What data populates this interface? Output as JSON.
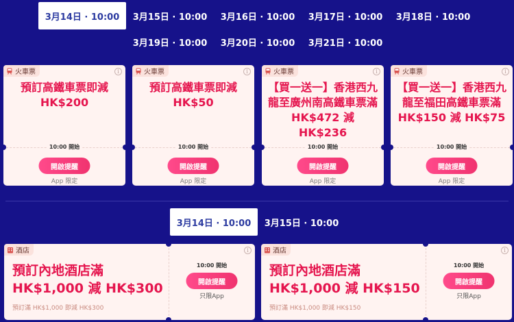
{
  "train_dates": [
    {
      "label": "3月14日 · 10:00",
      "active": true
    },
    {
      "label": "3月15日 · 10:00",
      "active": false
    },
    {
      "label": "3月16日 · 10:00",
      "active": false
    },
    {
      "label": "3月17日 · 10:00",
      "active": false
    },
    {
      "label": "3月18日 · 10:00",
      "active": false
    },
    {
      "label": "3月19日 · 10:00",
      "active": false
    },
    {
      "label": "3月20日 · 10:00",
      "active": false
    },
    {
      "label": "3月21日 · 10:00",
      "active": false
    }
  ],
  "train_cards": [
    {
      "tag": "火車票",
      "title": "預訂高鐵車票即減 HK$200",
      "time": "10:00 開始",
      "button": "開啟提醒",
      "limit": "App 限定"
    },
    {
      "tag": "火車票",
      "title": "預訂高鐵車票即減 HK$50",
      "time": "10:00 開始",
      "button": "開啟提醒",
      "limit": "App 限定"
    },
    {
      "tag": "火車票",
      "title": "【買一送一】香港西九龍至廣州南高鐵車票滿 HK$472 減 HK$236",
      "time": "10:00 開始",
      "button": "開啟提醒",
      "limit": "App 限定"
    },
    {
      "tag": "火車票",
      "title": "【買一送一】香港西九龍至福田高鐵車票滿 HK$150 減 HK$75",
      "time": "10:00 開始",
      "button": "開啟提醒",
      "limit": "App 限定"
    }
  ],
  "hotel_dates": [
    {
      "label": "3月14日 · 10:00",
      "active": true
    },
    {
      "label": "3月15日 · 10:00",
      "active": false
    }
  ],
  "hotel_cards": [
    {
      "tag": "酒店",
      "title_line1": "預訂內地酒店滿",
      "title_line2": "HK$1,000 減 HK$300",
      "subtitle": "預訂滿 HK$1,000 即減 HK$300",
      "time": "10:00 開始",
      "button": "開啟提醒",
      "limit": "只限App"
    },
    {
      "tag": "酒店",
      "title_line1": "預訂內地酒店滿",
      "title_line2": "HK$1,000 減 HK$150",
      "subtitle": "預訂滿 HK$1,000 即減 HK$150",
      "time": "10:00 開始",
      "button": "開啟提醒",
      "limit": "只限App"
    }
  ],
  "colors": {
    "background": "#16128a",
    "accent": "#e5154e",
    "button": "#f0336f"
  }
}
